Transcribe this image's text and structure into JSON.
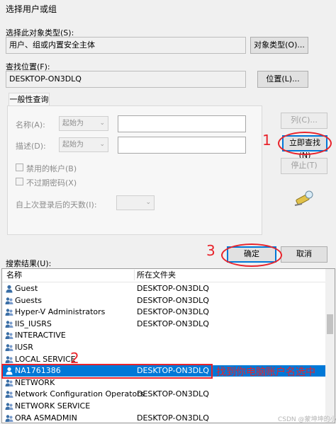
{
  "dialog": {
    "title": "选择用户或组"
  },
  "object_type": {
    "label": "选择此对象类型(S):",
    "value": "用户、组或内置安全主体",
    "button": "对象类型(O)..."
  },
  "location": {
    "label": "查找位置(F):",
    "value": "DESKTOP-ON3DLQ",
    "button": "位置(L)..."
  },
  "query": {
    "tab": "一般性查询",
    "name_label": "名称(A):",
    "name_mode": "起始为",
    "desc_label": "描述(D):",
    "desc_mode": "起始为",
    "disabled_label": "禁用的帐户(B)",
    "nonexpiring_label": "不过期密码(X)",
    "days_label": "自上次登录后的天数(I):"
  },
  "buttons": {
    "columns": "列(C)...",
    "find_now": "立即查找(N)",
    "stop": "停止(T)",
    "ok": "确定",
    "cancel": "取消"
  },
  "results": {
    "label": "搜索结果(U):",
    "columns": [
      "名称",
      "所在文件夹"
    ],
    "rows": [
      {
        "name": "Guest",
        "folder": "DESKTOP-ON3DLQ",
        "icon": "user-icon"
      },
      {
        "name": "Guests",
        "folder": "DESKTOP-ON3DLQ",
        "icon": "group-icon"
      },
      {
        "name": "Hyper-V Administrators",
        "folder": "DESKTOP-ON3DLQ",
        "icon": "group-icon"
      },
      {
        "name": "IIS_IUSRS",
        "folder": "DESKTOP-ON3DLQ",
        "icon": "group-icon"
      },
      {
        "name": "INTERACTIVE",
        "folder": "",
        "icon": "group-icon"
      },
      {
        "name": "IUSR",
        "folder": "",
        "icon": "group-icon"
      },
      {
        "name": "LOCAL SERVICE",
        "folder": "",
        "icon": "group-icon"
      },
      {
        "name": "NA1761386",
        "folder": "DESKTOP-ON3DLQ",
        "icon": "user-icon",
        "selected": true
      },
      {
        "name": "NETWORK",
        "folder": "",
        "icon": "group-icon"
      },
      {
        "name": "Network Configuration Operators",
        "folder": "DESKTOP-ON3DLQ",
        "icon": "group-icon"
      },
      {
        "name": "NETWORK SERVICE",
        "folder": "",
        "icon": "group-icon"
      },
      {
        "name": "ORA ASMADMIN",
        "folder": "DESKTOP-ON3DLQ",
        "icon": "group-icon"
      }
    ]
  },
  "annotations": {
    "step1": "1",
    "step2": "2",
    "step3": "3",
    "note": "找到你电脑账户名选中",
    "watermark": "CSDN @蒙坤坤的小书屋"
  },
  "colors": {
    "accent": "#0078d7",
    "annotation": "#e8232b"
  }
}
